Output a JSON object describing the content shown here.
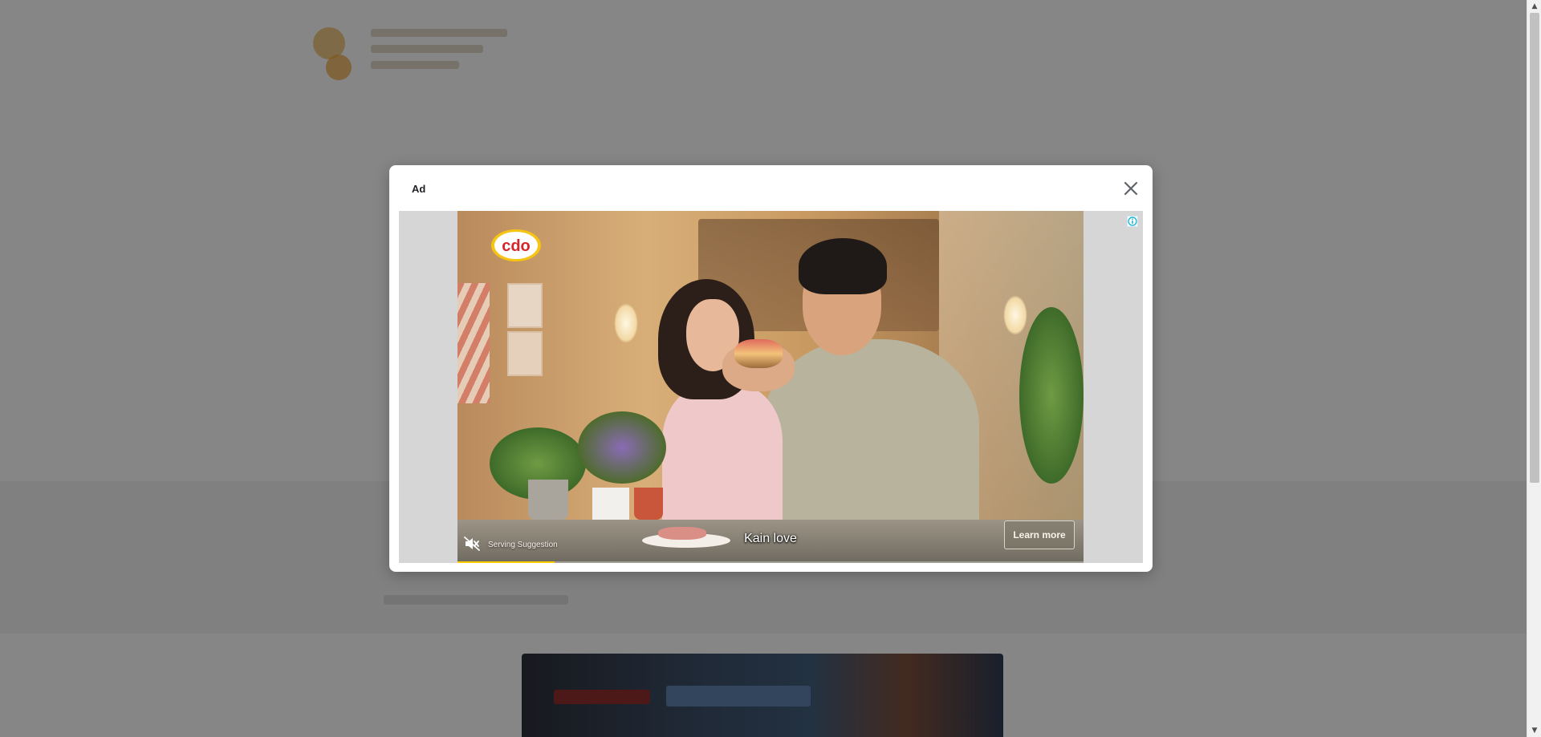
{
  "background_page": {
    "headline": ""
  },
  "modal": {
    "title": "Ad",
    "close_icon": "close-icon",
    "adchoices_icon": "info-icon"
  },
  "video_ad": {
    "brand_logo_text": "cdo",
    "serving_suggestion": "Serving Suggestion",
    "caption": "Kain love",
    "learn_more_label": "Learn more",
    "mute_icon": "speaker-muted-icon",
    "progress_fraction": 0.155
  },
  "colors": {
    "brand_red": "#d7262b",
    "brand_yellow": "#f6c514",
    "progress": "#ffcc00",
    "adchoices_blue": "#00aecd"
  }
}
